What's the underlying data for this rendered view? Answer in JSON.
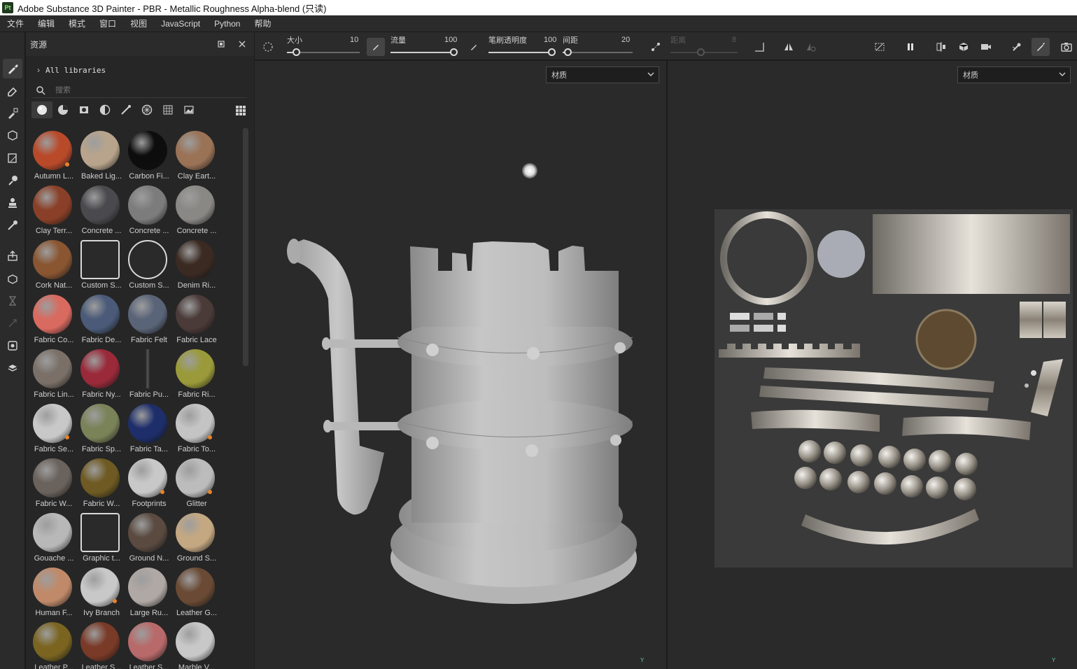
{
  "window": {
    "title": "Adobe Substance 3D Painter - PBR - Metallic Roughness Alpha-blend (只读)",
    "logo": "Pt"
  },
  "menu": [
    "文件",
    "编辑",
    "模式",
    "窗口",
    "视图",
    "JavaScript",
    "Python",
    "帮助"
  ],
  "left_tools": [
    "paint-brush-icon",
    "eraser-icon",
    "projection-icon",
    "geometry-mask-icon",
    "polygon-fill-icon",
    "smudge-icon",
    "clone-icon",
    "color-picker-icon",
    "export-icon",
    "bake-icon",
    "history-icon",
    "sync-icon",
    "display-settings-icon",
    "shader-settings-icon"
  ],
  "assets": {
    "title": "资源",
    "library": "All libraries",
    "search_placeholder": "搜索",
    "filters": [
      "materials-filter-icon",
      "smart-materials-filter-icon",
      "masks-filter-icon",
      "generators-filter-icon",
      "brushes-filter-icon",
      "textures-filter-icon",
      "alphas-filter-icon",
      "environments-filter-icon"
    ],
    "items": [
      {
        "label": "Autumn L...",
        "color": "#b84a2a",
        "badge": true
      },
      {
        "label": "Baked Lig...",
        "color": "#b8a48c",
        "badge": false
      },
      {
        "label": "Carbon Fi...",
        "color": "#0d0d0d",
        "badge": false
      },
      {
        "label": "Clay Eart...",
        "color": "#9a7256",
        "badge": false
      },
      {
        "label": "Clay Terr...",
        "color": "#8a4028",
        "badge": false
      },
      {
        "label": "Concrete ...",
        "color": "#4a4a4e",
        "badge": false
      },
      {
        "label": "Concrete ...",
        "color": "#7c7c7c",
        "badge": false
      },
      {
        "label": "Concrete ...",
        "color": "#8a8884",
        "badge": false
      },
      {
        "label": "Cork Nat...",
        "color": "#8a5632",
        "badge": false
      },
      {
        "label": "Custom S...",
        "color": "special-doc",
        "badge": false
      },
      {
        "label": "Custom S...",
        "color": "special-face",
        "badge": false
      },
      {
        "label": "Denim Ri...",
        "color": "#3a2a22",
        "badge": false
      },
      {
        "label": "Fabric Co...",
        "color": "#d86a60",
        "badge": false
      },
      {
        "label": "Fabric De...",
        "color": "#4a5a78",
        "badge": false
      },
      {
        "label": "Fabric Felt",
        "color": "#5a6478",
        "badge": false
      },
      {
        "label": "Fabric Lace",
        "color": "#4a3a38",
        "badge": false
      },
      {
        "label": "Fabric Lin...",
        "color": "#7a7068",
        "badge": false
      },
      {
        "label": "Fabric Ny...",
        "color": "#9a2a3a",
        "badge": false
      },
      {
        "label": "Fabric Pu...",
        "color": "special-pull",
        "badge": false
      },
      {
        "label": "Fabric Ri...",
        "color": "#9a9a3a",
        "badge": false
      },
      {
        "label": "Fabric Se...",
        "color": "#c8c8c8",
        "badge": true
      },
      {
        "label": "Fabric Sp...",
        "color": "#7a8258",
        "badge": false
      },
      {
        "label": "Fabric Ta...",
        "color": "#1e2e6a",
        "badge": false
      },
      {
        "label": "Fabric To...",
        "color": "#c4c4c4",
        "badge": true
      },
      {
        "label": "Fabric W...",
        "color": "#6a625c",
        "badge": false
      },
      {
        "label": "Fabric W...",
        "color": "#6e5a22",
        "badge": false
      },
      {
        "label": "Footprints",
        "color": "#c8c8c8",
        "badge": true
      },
      {
        "label": "Glitter",
        "color": "#bcbcbc",
        "badge": true
      },
      {
        "label": "Gouache ...",
        "color": "#b8b8b8",
        "badge": false
      },
      {
        "label": "Graphic t...",
        "color": "special-doc2",
        "badge": false
      },
      {
        "label": "Ground N...",
        "color": "#5a4a40",
        "badge": false
      },
      {
        "label": "Ground S...",
        "color": "#c4a882",
        "badge": false
      },
      {
        "label": "Human F...",
        "color": "#c08a6a",
        "badge": false
      },
      {
        "label": "Ivy Branch",
        "color": "#c8c8c8",
        "badge": true
      },
      {
        "label": "Large Ru...",
        "color": "#b0a8a4",
        "badge": false
      },
      {
        "label": "Leather G...",
        "color": "#6a4a34",
        "badge": false
      },
      {
        "label": "Leather P...",
        "color": "#7a6420",
        "badge": false
      },
      {
        "label": "Leather S...",
        "color": "#7a3a28",
        "badge": false
      },
      {
        "label": "Leather S...",
        "color": "#b86a6a",
        "badge": false
      },
      {
        "label": "Marble V...",
        "color": "#c8c8c8",
        "badge": false
      }
    ]
  },
  "properties": {
    "size_label": "大小",
    "size_value": "10",
    "size_fraction": 0.09,
    "flow_label": "流量",
    "flow_value": "100",
    "flow_fraction": 1.0,
    "opacity_label": "笔刷透明度",
    "opacity_value": "100",
    "opacity_fraction": 1.0,
    "spacing_label": "间距",
    "spacing_value": "20",
    "spacing_fraction": 0.02,
    "distance_label": "距离",
    "distance_value": "8",
    "distance_fraction": 0.45
  },
  "viewports": {
    "channel_3d": "材质",
    "channel_2d": "材质",
    "axis_3d": "Y",
    "axis_2d": "Y"
  }
}
